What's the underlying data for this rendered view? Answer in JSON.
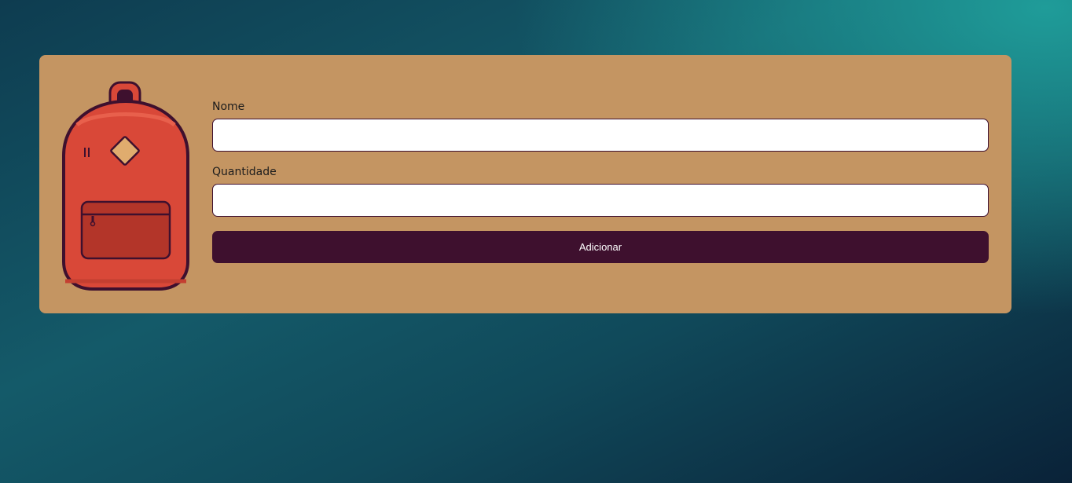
{
  "form": {
    "name_label": "Nome",
    "name_value": "",
    "quantity_label": "Quantidade",
    "quantity_value": "",
    "submit_label": "Adicionar"
  },
  "illustration": {
    "icon": "backpack-icon"
  },
  "colors": {
    "card": "#c49562",
    "button": "#3e102e",
    "backpack": "#d94838",
    "backpack_outline": "#3e102e"
  }
}
